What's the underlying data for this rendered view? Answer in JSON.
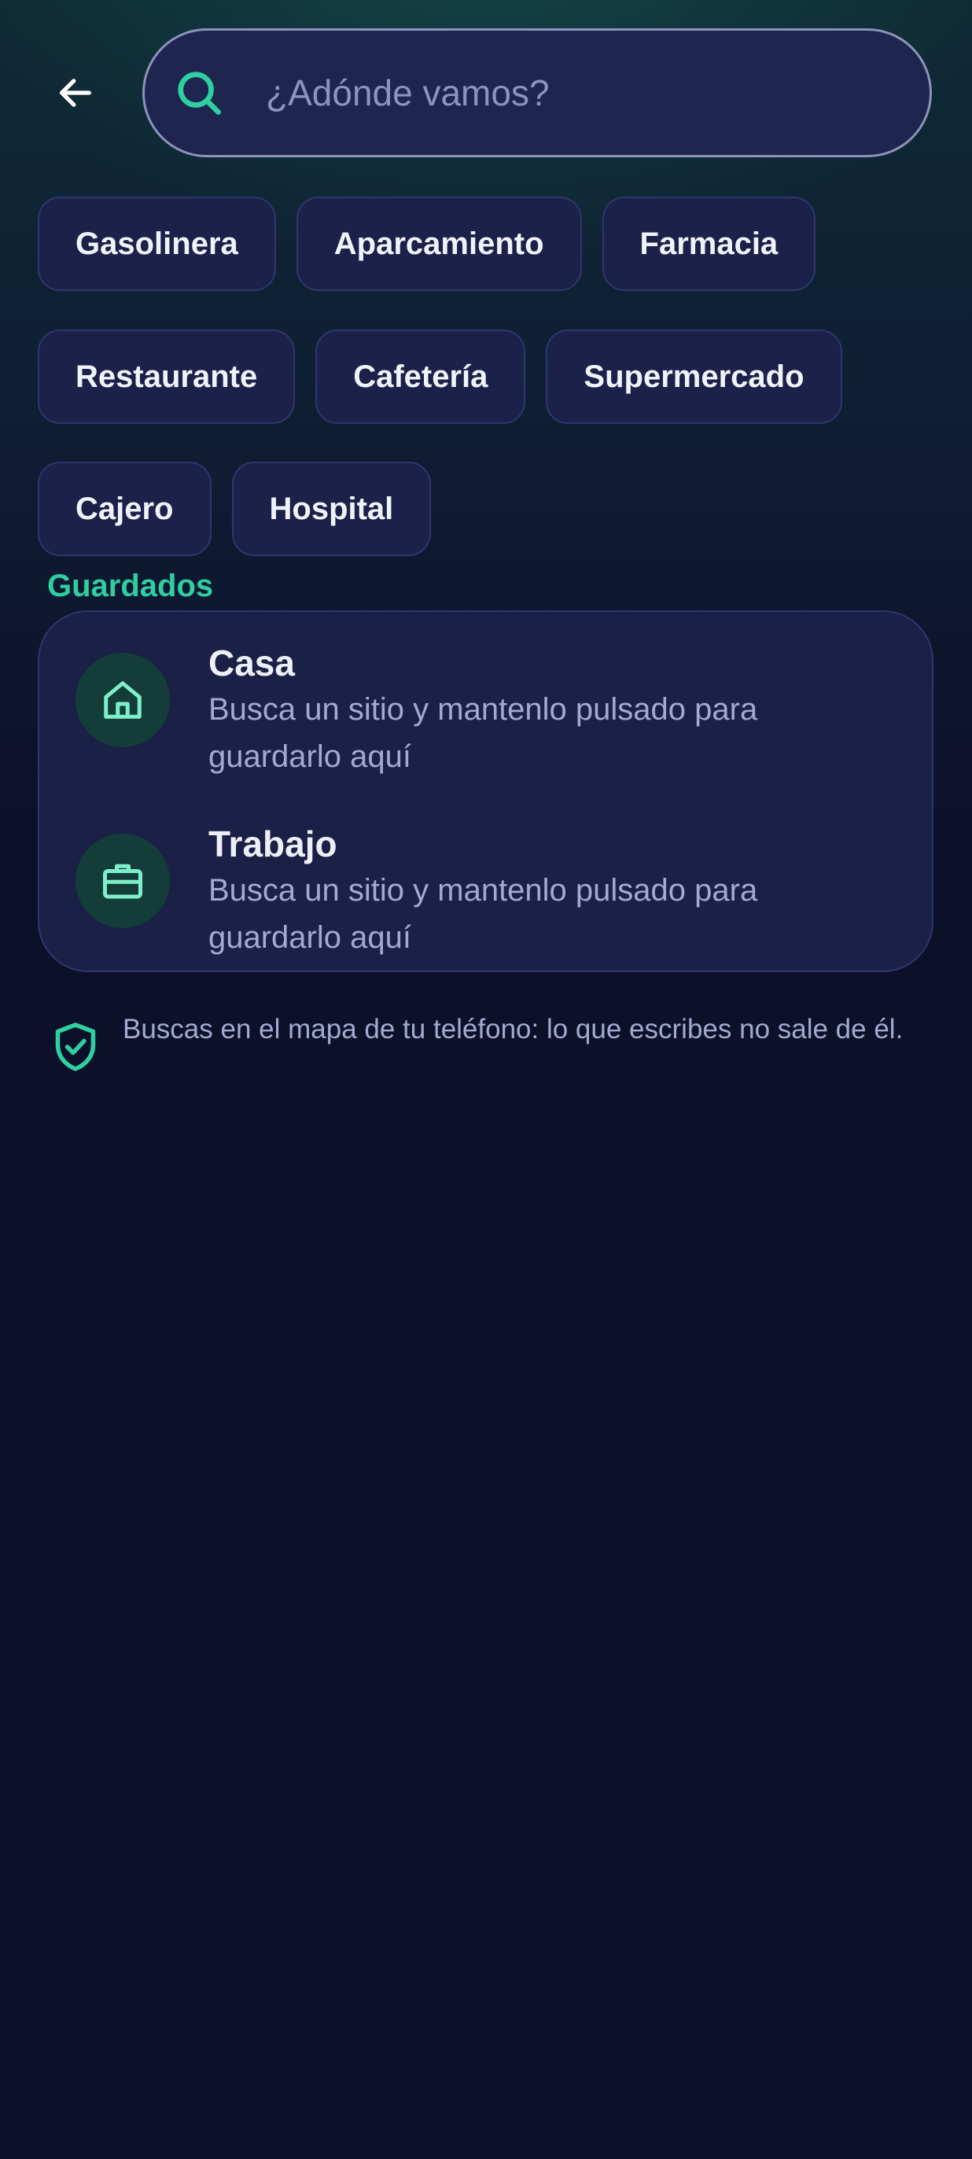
{
  "header": {
    "back_icon": "arrow-left-icon",
    "search": {
      "icon": "search-icon",
      "placeholder": "¿Adónde vamos?",
      "value": ""
    }
  },
  "categories": {
    "rows": [
      [
        "Gasolinera",
        "Aparcamiento",
        "Farmacia"
      ],
      [
        "Restaurante",
        "Cafetería",
        "Supermercado"
      ],
      [
        "Cajero",
        "Hospital"
      ]
    ]
  },
  "saved": {
    "title": "Guardados",
    "items": [
      {
        "icon": "home-icon",
        "title": "Casa",
        "subtitle": "Busca un sitio y mantenlo pulsado para guardarlo aquí"
      },
      {
        "icon": "briefcase-icon",
        "title": "Trabajo",
        "subtitle": "Busca un sitio y mantenlo pulsado para guardarlo aquí"
      }
    ]
  },
  "privacy": {
    "icon": "shield-check-icon",
    "text": "Buscas en el mapa de tu teléfono: lo que escribes no sale de él."
  },
  "colors": {
    "accent": "#2ecfa1",
    "background": "#0d1029",
    "card": "#1a2046",
    "chip": "#1b2148",
    "search_field": "#1e2650",
    "muted_text": "#a3aad0"
  }
}
